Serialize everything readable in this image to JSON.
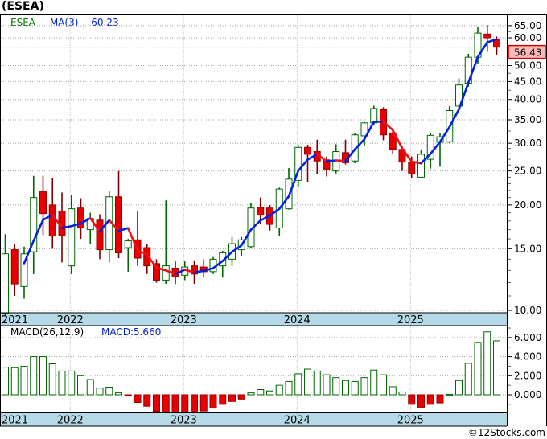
{
  "title": "(ESEA)",
  "legend": {
    "symbol": "ESEA",
    "ma_label": "MA(3)",
    "ma_value": "60.23"
  },
  "macd_legend": {
    "label": "MACD(26,12,9)",
    "value_label": "MACD:5.660"
  },
  "copyright": "©12Stocks.com",
  "colors": {
    "up_stroke": "#006600",
    "up_fill": "#ffffff",
    "down_fill": "#e60000",
    "down_stroke": "#990000",
    "down_wick": "#800000",
    "ma_up": "#0022dd",
    "ma_down": "#ee1111",
    "grid": "#a5a5a5",
    "band_bg": "#b5d9e7",
    "frame": "#000000",
    "price_line": "#c08080",
    "price_label_bg": "#ffb8b8",
    "price_label_border": "#cc0000"
  },
  "price_axis": {
    "current_label": "56.43",
    "ticks": [
      {
        "label": "65.00",
        "value": 65
      },
      {
        "label": "60.00",
        "value": 60
      },
      {
        "label": "50.00",
        "value": 50
      },
      {
        "label": "45.00",
        "value": 45
      },
      {
        "label": "40.00",
        "value": 40
      },
      {
        "label": "35.00",
        "value": 35
      },
      {
        "label": "30.00",
        "value": 30
      },
      {
        "label": "25.00",
        "value": 25
      },
      {
        "label": "20.00",
        "value": 20
      },
      {
        "label": "15.00",
        "value": 15
      },
      {
        "label": "10.00",
        "value": 10
      }
    ],
    "minor_ticks": [
      62.5,
      55,
      52.5,
      47.5,
      42.5,
      37.5,
      32.5,
      29,
      28,
      27,
      26,
      24,
      23,
      22,
      21,
      19,
      18,
      17,
      16,
      14,
      13,
      12,
      11
    ]
  },
  "macd_axis": {
    "ticks": [
      {
        "label": "6.000",
        "value": 6
      },
      {
        "label": "4.000",
        "value": 4
      },
      {
        "label": "2.000",
        "value": 2
      },
      {
        "label": "0.000",
        "value": 0
      }
    ],
    "minor_ticks": [
      7,
      5,
      3,
      1,
      -1
    ]
  },
  "x_axis": {
    "years": [
      {
        "label": "2021",
        "month_index": -1
      },
      {
        "label": "2022",
        "month_index": 7
      },
      {
        "label": "2023",
        "month_index": 19
      },
      {
        "label": "2024",
        "month_index": 31
      },
      {
        "label": "2025",
        "month_index": 43
      }
    ]
  },
  "chart_data": {
    "type": "candlestick+macd",
    "symbol": "ESEA",
    "title": "(ESEA)",
    "scale": "log",
    "price_range_shown": [
      10,
      65
    ],
    "macd_range_shown": [
      -2.1,
      7.1
    ],
    "current_price": 56.43,
    "ma3_display_value": 60.23,
    "macd_display_value": 5.66,
    "months": [
      "2021-06",
      "2021-07",
      "2021-08",
      "2021-09",
      "2021-10",
      "2021-11",
      "2021-12",
      "2022-01",
      "2022-02",
      "2022-03",
      "2022-04",
      "2022-05",
      "2022-06",
      "2022-07",
      "2022-08",
      "2022-09",
      "2022-10",
      "2022-11",
      "2022-12",
      "2023-01",
      "2023-02",
      "2023-03",
      "2023-04",
      "2023-05",
      "2023-06",
      "2023-07",
      "2023-08",
      "2023-09",
      "2023-10",
      "2023-11",
      "2023-12",
      "2024-01",
      "2024-02",
      "2024-03",
      "2024-04",
      "2024-05",
      "2024-06",
      "2024-07",
      "2024-08",
      "2024-09",
      "2024-10",
      "2024-11",
      "2024-12",
      "2025-01",
      "2025-02",
      "2025-03",
      "2025-04",
      "2025-05",
      "2025-06",
      "2025-07",
      "2025-08",
      "2025-09",
      "2025-10"
    ],
    "ohlc": [
      [
        9.8,
        16.5,
        9.6,
        14.5
      ],
      [
        14.9,
        15.5,
        11.0,
        11.9
      ],
      [
        11.7,
        15.2,
        10.8,
        14.5
      ],
      [
        14.7,
        24.2,
        12.7,
        21.0
      ],
      [
        21.8,
        24.2,
        16.4,
        18.9
      ],
      [
        20.0,
        23.8,
        15.0,
        16.3
      ],
      [
        19.2,
        21.7,
        13.7,
        16.4
      ],
      [
        13.4,
        21.3,
        12.7,
        19.5
      ],
      [
        19.6,
        20.9,
        16.0,
        17.2
      ],
      [
        17.0,
        19.0,
        15.5,
        18.3
      ],
      [
        18.1,
        18.8,
        14.0,
        14.9
      ],
      [
        14.9,
        21.9,
        13.7,
        21.1
      ],
      [
        21.1,
        25.0,
        14.1,
        14.6
      ],
      [
        15.1,
        16.0,
        12.9,
        15.8
      ],
      [
        15.9,
        19.2,
        13.4,
        14.1
      ],
      [
        15.1,
        15.5,
        12.7,
        13.4
      ],
      [
        13.6,
        14.0,
        12.0,
        12.2
      ],
      [
        12.2,
        20.6,
        11.9,
        13.4
      ],
      [
        13.2,
        13.8,
        11.9,
        12.5
      ],
      [
        12.6,
        13.8,
        12.2,
        13.3
      ],
      [
        13.4,
        13.9,
        11.9,
        12.7
      ],
      [
        13.3,
        14.0,
        12.4,
        12.9
      ],
      [
        12.9,
        14.2,
        12.7,
        14.0
      ],
      [
        13.4,
        14.8,
        12.4,
        14.6
      ],
      [
        14.0,
        16.2,
        13.4,
        15.5
      ],
      [
        14.9,
        16.2,
        14.3,
        15.9
      ],
      [
        15.2,
        20.3,
        15.1,
        19.6
      ],
      [
        19.7,
        21.0,
        17.6,
        18.7
      ],
      [
        19.6,
        20.0,
        16.9,
        17.6
      ],
      [
        17.2,
        22.4,
        16.3,
        22.2
      ],
      [
        19.5,
        25.5,
        19.4,
        23.7
      ],
      [
        23.5,
        29.7,
        22.5,
        29.2
      ],
      [
        29.2,
        29.7,
        23.3,
        27.9
      ],
      [
        28.4,
        30.7,
        24.5,
        26.7
      ],
      [
        26.9,
        27.5,
        24.1,
        25.3
      ],
      [
        25.0,
        29.8,
        24.6,
        28.4
      ],
      [
        28.2,
        30.7,
        26.1,
        26.4
      ],
      [
        26.7,
        32.0,
        26.3,
        31.7
      ],
      [
        31.5,
        34.5,
        29.5,
        34.3
      ],
      [
        34.3,
        38.4,
        33.7,
        37.7
      ],
      [
        37.4,
        38.0,
        30.6,
        31.7
      ],
      [
        32.1,
        32.5,
        27.9,
        28.8
      ],
      [
        28.8,
        29.5,
        25.0,
        26.5
      ],
      [
        26.5,
        27.5,
        23.9,
        24.5
      ],
      [
        24.0,
        28.8,
        23.9,
        27.9
      ],
      [
        27.0,
        32.0,
        25.4,
        31.6
      ],
      [
        30.2,
        32.0,
        25.7,
        31.3
      ],
      [
        30.3,
        38.3,
        30.0,
        37.2
      ],
      [
        38.3,
        46.0,
        37.5,
        44.0
      ],
      [
        44.5,
        54.0,
        43.5,
        52.8
      ],
      [
        52.8,
        64.5,
        50.5,
        61.9
      ],
      [
        61.5,
        65.3,
        54.7,
        60.0
      ],
      [
        59.5,
        60.5,
        53.6,
        56.43
      ]
    ],
    "macd": [
      2.9,
      2.85,
      3.0,
      4.0,
      4.0,
      3.25,
      2.5,
      2.5,
      2.0,
      1.6,
      0.7,
      0.8,
      0.2,
      -0.08,
      -0.8,
      -1.2,
      -1.75,
      -1.9,
      -2.0,
      -2.0,
      -1.9,
      -1.7,
      -1.4,
      -1.0,
      -0.7,
      -0.45,
      0.2,
      0.55,
      0.4,
      1.0,
      1.4,
      2.2,
      2.7,
      2.5,
      2.1,
      1.8,
      1.5,
      1.4,
      1.8,
      2.6,
      2.1,
      0.85,
      0.3,
      -1.0,
      -1.3,
      -1.0,
      -0.85,
      0.05,
      1.5,
      3.3,
      5.5,
      6.6,
      5.66
    ]
  }
}
